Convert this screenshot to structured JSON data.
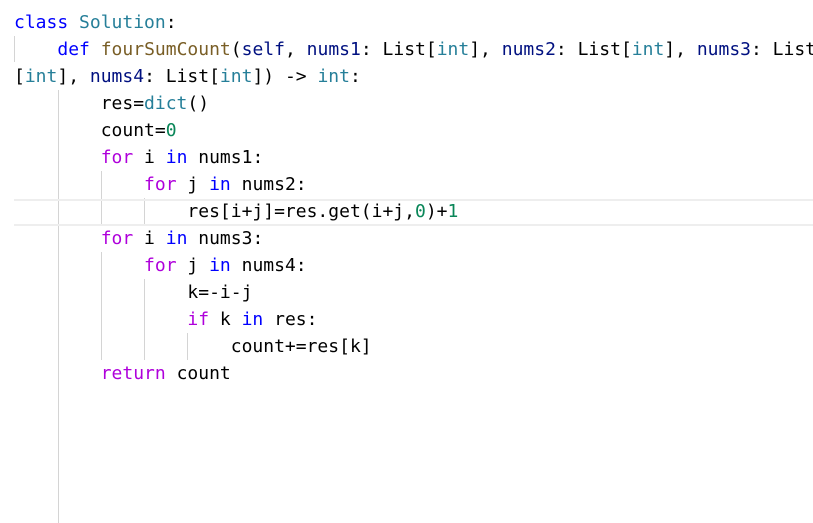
{
  "editor": {
    "language": "python",
    "colors": {
      "background": "#ffffff",
      "keyword": "#0000ff",
      "control_keyword": "#af00db",
      "type": "#267f99",
      "function": "#795e26",
      "parameter": "#001080",
      "number": "#098658",
      "text": "#000000",
      "indent_guide": "#d4d4d4",
      "current_line_border": "#eeeeee"
    },
    "lines": [
      [
        {
          "t": "class",
          "c": "kw"
        },
        {
          "t": " ",
          "c": "plain"
        },
        {
          "t": "Solution",
          "c": "cls"
        },
        {
          "t": ":",
          "c": "plain"
        }
      ],
      [
        {
          "t": "    ",
          "c": "plain"
        },
        {
          "t": "def",
          "c": "kw"
        },
        {
          "t": " ",
          "c": "plain"
        },
        {
          "t": "fourSumCount",
          "c": "fn"
        },
        {
          "t": "(",
          "c": "plain"
        },
        {
          "t": "self",
          "c": "param"
        },
        {
          "t": ", ",
          "c": "plain"
        },
        {
          "t": "nums1",
          "c": "param"
        },
        {
          "t": ": List[",
          "c": "plain"
        },
        {
          "t": "int",
          "c": "cls"
        },
        {
          "t": "], ",
          "c": "plain"
        },
        {
          "t": "nums2",
          "c": "param"
        },
        {
          "t": ": List[",
          "c": "plain"
        },
        {
          "t": "int",
          "c": "cls"
        },
        {
          "t": "], ",
          "c": "plain"
        },
        {
          "t": "nums3",
          "c": "param"
        },
        {
          "t": ": List",
          "c": "plain"
        }
      ],
      [
        {
          "t": "[",
          "c": "plain"
        },
        {
          "t": "int",
          "c": "cls"
        },
        {
          "t": "], ",
          "c": "plain"
        },
        {
          "t": "nums4",
          "c": "param"
        },
        {
          "t": ": List[",
          "c": "plain"
        },
        {
          "t": "int",
          "c": "cls"
        },
        {
          "t": "]) -> ",
          "c": "plain"
        },
        {
          "t": "int",
          "c": "cls"
        },
        {
          "t": ":",
          "c": "plain"
        }
      ],
      [
        {
          "t": "        res=",
          "c": "plain"
        },
        {
          "t": "dict",
          "c": "cls"
        },
        {
          "t": "()",
          "c": "plain"
        }
      ],
      [
        {
          "t": "        count=",
          "c": "plain"
        },
        {
          "t": "0",
          "c": "num"
        }
      ],
      [
        {
          "t": "        ",
          "c": "plain"
        },
        {
          "t": "for",
          "c": "kw2"
        },
        {
          "t": " i ",
          "c": "plain"
        },
        {
          "t": "in",
          "c": "kw"
        },
        {
          "t": " nums1:",
          "c": "plain"
        }
      ],
      [
        {
          "t": "            ",
          "c": "plain"
        },
        {
          "t": "for",
          "c": "kw2"
        },
        {
          "t": " j ",
          "c": "plain"
        },
        {
          "t": "in",
          "c": "kw"
        },
        {
          "t": " nums2:",
          "c": "plain"
        }
      ],
      [
        {
          "t": "                res[i+j]=res.get(i+j,",
          "c": "plain"
        },
        {
          "t": "0",
          "c": "num"
        },
        {
          "t": ")+",
          "c": "plain"
        },
        {
          "t": "1",
          "c": "num"
        }
      ],
      [
        {
          "t": "        ",
          "c": "plain"
        },
        {
          "t": "for",
          "c": "kw2"
        },
        {
          "t": " i ",
          "c": "plain"
        },
        {
          "t": "in",
          "c": "kw"
        },
        {
          "t": " nums3:",
          "c": "plain"
        }
      ],
      [
        {
          "t": "            ",
          "c": "plain"
        },
        {
          "t": "for",
          "c": "kw2"
        },
        {
          "t": " j ",
          "c": "plain"
        },
        {
          "t": "in",
          "c": "kw"
        },
        {
          "t": " nums4:",
          "c": "plain"
        }
      ],
      [
        {
          "t": "                k=-i-j",
          "c": "plain"
        }
      ],
      [
        {
          "t": "                ",
          "c": "plain"
        },
        {
          "t": "if",
          "c": "kw2"
        },
        {
          "t": " k ",
          "c": "plain"
        },
        {
          "t": "in",
          "c": "kw"
        },
        {
          "t": " res:",
          "c": "plain"
        }
      ],
      [
        {
          "t": "                    count+=res[k]",
          "c": "plain"
        }
      ],
      [
        {
          "t": "        ",
          "c": "plain"
        },
        {
          "t": "return",
          "c": "kw2"
        },
        {
          "t": " count",
          "c": "plain"
        }
      ]
    ]
  }
}
